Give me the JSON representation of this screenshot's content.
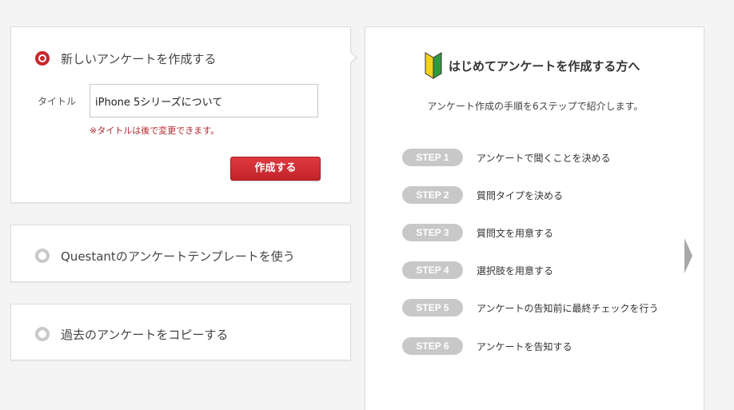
{
  "create_option": {
    "label": "新しいアンケートを作成する",
    "title_label": "タイトル",
    "title_value": "iPhone 5シリーズについて",
    "note": "※タイトルは後で変更できます。",
    "button_label": "作成する"
  },
  "template_option": {
    "label": "Questantのアンケートテンプレートを使う"
  },
  "copy_option": {
    "label": "過去のアンケートをコピーする"
  },
  "guide": {
    "title": "はじめてアンケートを作成する方へ",
    "subtitle": "アンケート作成の手順を6ステップで紹介します。",
    "steps": [
      {
        "badge": "STEP 1",
        "text": "アンケートで聞くことを決める"
      },
      {
        "badge": "STEP 2",
        "text": "質問タイプを決める"
      },
      {
        "badge": "STEP 3",
        "text": "質問文を用意する"
      },
      {
        "badge": "STEP 4",
        "text": "選択肢を用意する"
      },
      {
        "badge": "STEP 5",
        "text": "アンケートの告知前に最終チェックを行う"
      },
      {
        "badge": "STEP 6",
        "text": "アンケートを告知する"
      }
    ]
  },
  "colors": {
    "accent": "#c8262c",
    "badge": "#c8c8c8"
  },
  "icons": [
    "radio-selected-icon",
    "radio-unselected-icon",
    "beginner-mark-icon",
    "chevron-right-icon"
  ]
}
